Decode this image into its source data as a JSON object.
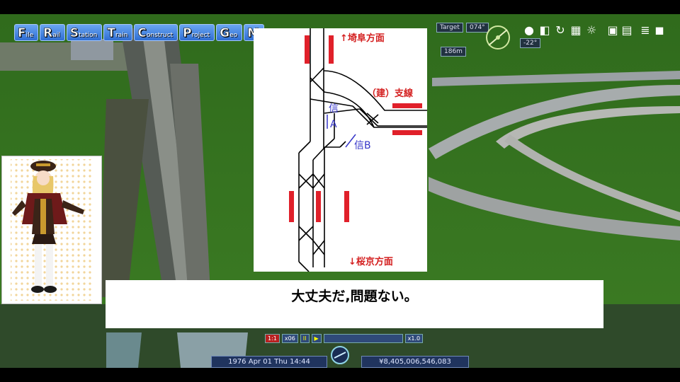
{
  "menu": [
    {
      "initial": "F",
      "rest": "ile"
    },
    {
      "initial": "R",
      "rest": "ail"
    },
    {
      "initial": "S",
      "rest": "tation"
    },
    {
      "initial": "T",
      "rest": "rain"
    },
    {
      "initial": "C",
      "rest": "onstruct"
    },
    {
      "initial": "P",
      "rest": "roject"
    },
    {
      "initial": "G",
      "rest": "eo"
    },
    {
      "initial": "M",
      "rest": ""
    }
  ],
  "hud": {
    "target_label": "Target",
    "heading": "074°",
    "tilt": "-22°",
    "altitude": "186m"
  },
  "diagram": {
    "north_label": "↑埼阜方面",
    "branch_label": "（建）支線",
    "signal_a": "信",
    "signal_a_letter": "A",
    "signal_b": "信B",
    "south_label": "↓桜京方面"
  },
  "dialog": {
    "text": "大丈夫だ,問題ない。"
  },
  "controls": {
    "ratio": "1:1",
    "speed_mult": "x06",
    "pause": "II",
    "play": "▶",
    "time_scale": "x1.0"
  },
  "status": {
    "datetime": "1976 Apr 01 Thu  14:44",
    "money": "¥8,405,006,546,083"
  },
  "colors": {
    "menu_blue": "#2f6ed3",
    "signal_red": "#e0202a",
    "label_red": "#d42020",
    "label_blue": "#3535c8"
  }
}
